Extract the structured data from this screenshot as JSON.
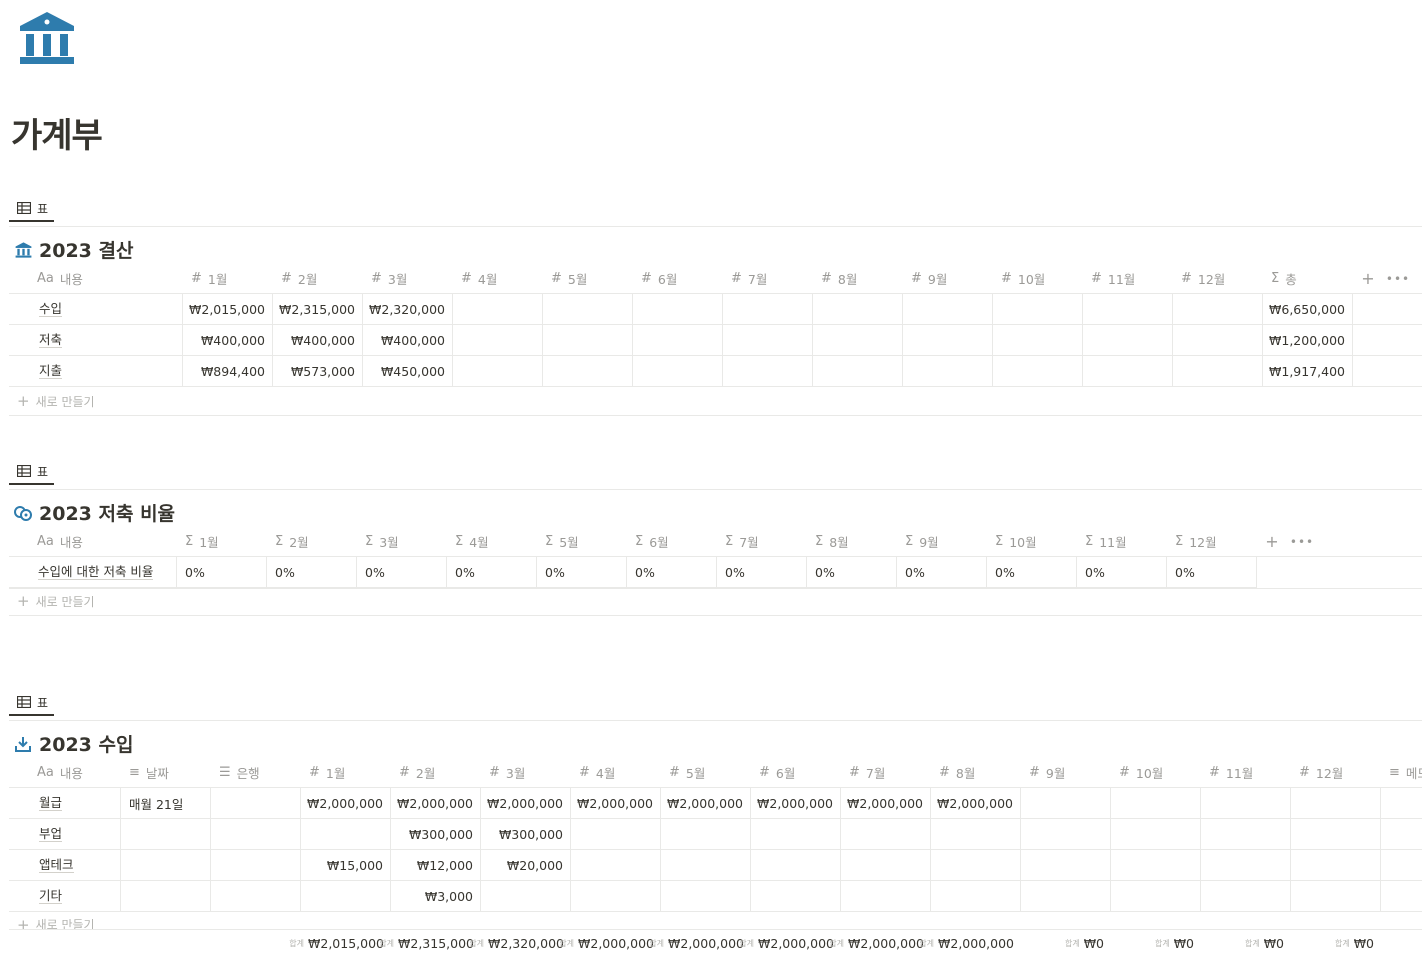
{
  "page": {
    "icon": "bank-icon",
    "title": "가계부"
  },
  "colors": {
    "icon_blue": "#2e7cad",
    "text": "#37352f",
    "muted": "#9b9a97",
    "border": "#e9e9e7"
  },
  "db1": {
    "view_tab": "표",
    "title": "2023 결산",
    "icon": "bank-icon",
    "headers": [
      "Aa 내용",
      "1월",
      "2월",
      "3월",
      "4월",
      "5월",
      "6월",
      "7월",
      "8월",
      "9월",
      "10월",
      "11월",
      "12월",
      "총"
    ],
    "name_header": "내용",
    "name_header_prefix": "Aa",
    "month_headers": [
      "1월",
      "2월",
      "3월",
      "4월",
      "5월",
      "6월",
      "7월",
      "8월",
      "9월",
      "10월",
      "11월",
      "12월"
    ],
    "total_header": "총",
    "rows": [
      {
        "name": "수입",
        "values": [
          "₩2,015,000",
          "₩2,315,000",
          "₩2,320,000",
          "",
          "",
          "",
          "",
          "",
          "",
          "",
          "",
          ""
        ],
        "total": "₩6,650,000"
      },
      {
        "name": "저축",
        "values": [
          "₩400,000",
          "₩400,000",
          "₩400,000",
          "",
          "",
          "",
          "",
          "",
          "",
          "",
          "",
          ""
        ],
        "total": "₩1,200,000"
      },
      {
        "name": "지출",
        "values": [
          "₩894,400",
          "₩573,000",
          "₩450,000",
          "",
          "",
          "",
          "",
          "",
          "",
          "",
          "",
          ""
        ],
        "total": "₩1,917,400"
      }
    ],
    "new_label": "새로 만들기"
  },
  "db2": {
    "view_tab": "표",
    "title": "2023 저축 비율",
    "icon": "coins-icon",
    "name_header": "내용",
    "name_header_prefix": "Aa",
    "month_headers": [
      "1월",
      "2월",
      "3월",
      "4월",
      "5월",
      "6월",
      "7월",
      "8월",
      "9월",
      "10월",
      "11월",
      "12월"
    ],
    "rows": [
      {
        "name": "수입에 대한 저축 비율",
        "values": [
          "0%",
          "0%",
          "0%",
          "0%",
          "0%",
          "0%",
          "0%",
          "0%",
          "0%",
          "0%",
          "0%",
          "0%"
        ]
      }
    ],
    "new_label": "새로 만들기"
  },
  "db3": {
    "view_tab": "표",
    "title": "2023 수입",
    "icon": "download-icon",
    "name_header": "내용",
    "name_header_prefix": "Aa",
    "date_header": "날짜",
    "bank_header": "은행",
    "month_headers": [
      "1월",
      "2월",
      "3월",
      "4월",
      "5월",
      "6월",
      "7월",
      "8월",
      "9월",
      "10월",
      "11월",
      "12월"
    ],
    "memo_header": "메모",
    "rows": [
      {
        "name": "월급",
        "date": "매월 21일",
        "bank": "",
        "values": [
          "₩2,000,000",
          "₩2,000,000",
          "₩2,000,000",
          "₩2,000,000",
          "₩2,000,000",
          "₩2,000,000",
          "₩2,000,000",
          "₩2,000,000",
          "",
          "",
          "",
          ""
        ]
      },
      {
        "name": "부업",
        "date": "",
        "bank": "",
        "values": [
          "",
          "₩300,000",
          "₩300,000",
          "",
          "",
          "",
          "",
          "",
          "",
          "",
          "",
          ""
        ]
      },
      {
        "name": "앱테크",
        "date": "",
        "bank": "",
        "values": [
          "₩15,000",
          "₩12,000",
          "₩20,000",
          "",
          "",
          "",
          "",
          "",
          "",
          "",
          "",
          ""
        ]
      },
      {
        "name": "기타",
        "date": "",
        "bank": "",
        "values": [
          "",
          "₩3,000",
          "",
          "",
          "",
          "",
          "",
          "",
          "",
          "",
          "",
          ""
        ]
      }
    ],
    "new_label": "새로 만들기",
    "calc_label": "합계",
    "calc_values": [
      "₩2,015,000",
      "₩2,315,000",
      "₩2,320,000",
      "₩2,000,000",
      "₩2,000,000",
      "₩2,000,000",
      "₩2,000,000",
      "₩2,000,000",
      "₩0",
      "₩0",
      "₩0",
      "₩0"
    ]
  }
}
